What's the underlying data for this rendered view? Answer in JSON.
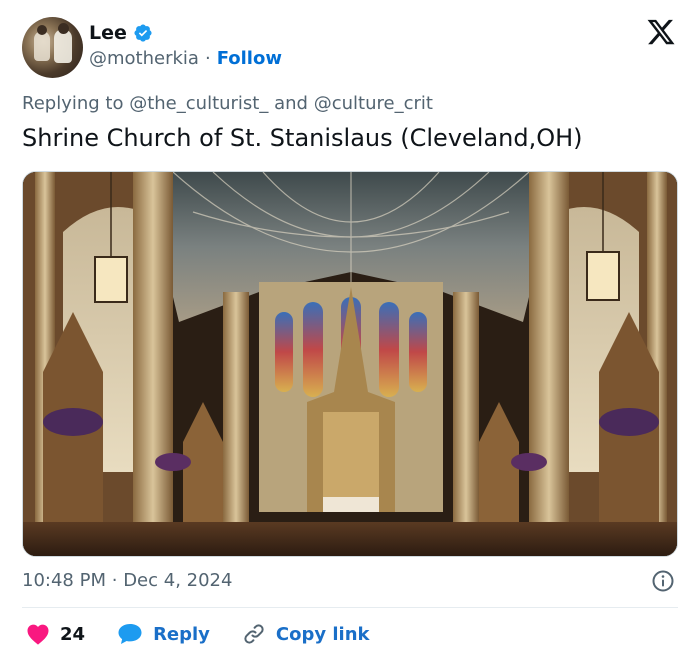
{
  "author": {
    "name": "Lee",
    "handle": "@motherkia",
    "separator": "·",
    "follow_label": "Follow"
  },
  "reply": {
    "prefix": "Replying to",
    "mention1": "@the_culturist_",
    "conjunction": "and",
    "mention2": "@culture_crit"
  },
  "tweet": {
    "text": "Shrine Church of St. Stanislaus (Cleveland,OH)"
  },
  "meta": {
    "time": "10:48 PM",
    "separator": "·",
    "date": "Dec 4, 2024"
  },
  "actions": {
    "like_count": "24",
    "reply_label": "Reply",
    "copy_label": "Copy link"
  },
  "colors": {
    "accent": "#1d9bf0",
    "link": "#006fd6",
    "like": "#f91880",
    "muted": "#536471"
  },
  "icons": {
    "verified": "verified-badge-icon",
    "brand": "x-logo-icon",
    "info": "info-icon",
    "like": "heart-icon",
    "reply": "speech-bubble-icon",
    "copy": "link-icon"
  }
}
